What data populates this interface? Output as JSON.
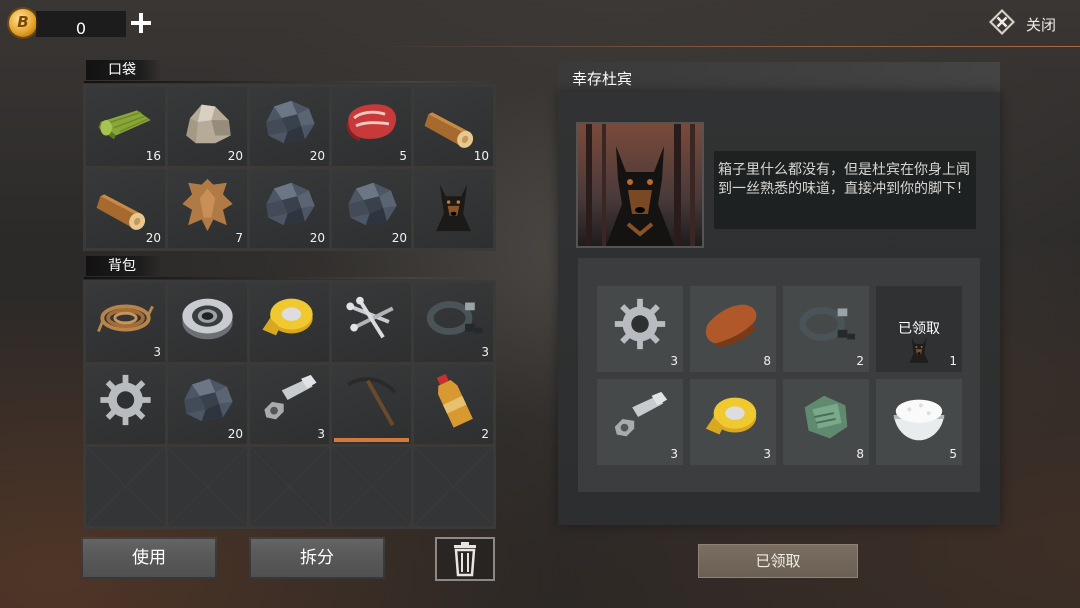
{
  "currency": {
    "icon": "gold-coin-icon",
    "symbol": "B",
    "amount": "0"
  },
  "close": {
    "label": "关闭"
  },
  "pocket": {
    "title": "口袋",
    "slots": [
      {
        "icon": "cloth-roll-icon",
        "qty": "16"
      },
      {
        "icon": "stone-icon",
        "qty": "20"
      },
      {
        "icon": "iron-ore-icon",
        "qty": "20"
      },
      {
        "icon": "raw-meat-icon",
        "qty": "5"
      },
      {
        "icon": "wood-log-icon",
        "qty": "10"
      },
      {
        "icon": "wood-log-icon",
        "qty": "20"
      },
      {
        "icon": "leather-hide-icon",
        "qty": "7"
      },
      {
        "icon": "iron-ore-icon",
        "qty": "20"
      },
      {
        "icon": "iron-ore-icon",
        "qty": "20"
      },
      {
        "icon": "dog-icon",
        "qty": ""
      }
    ]
  },
  "backpack": {
    "title": "背包",
    "slots": [
      {
        "icon": "rope-icon",
        "qty": "3"
      },
      {
        "icon": "bearing-icon",
        "qty": ""
      },
      {
        "icon": "duct-tape-icon",
        "qty": ""
      },
      {
        "icon": "nails-icon",
        "qty": ""
      },
      {
        "icon": "cable-ring-icon",
        "qty": "3"
      },
      {
        "icon": "gear-icon",
        "qty": ""
      },
      {
        "icon": "iron-ore-icon",
        "qty": "20"
      },
      {
        "icon": "bolt-nut-icon",
        "qty": "3"
      },
      {
        "icon": "pickaxe-icon",
        "qty": "",
        "durability": 1.0
      },
      {
        "icon": "bottle-icon",
        "qty": "2"
      }
    ]
  },
  "buttons": {
    "use": "使用",
    "split": "拆分"
  },
  "reward_panel": {
    "title": "幸存杜宾",
    "description": "箱子里什么都没有，但是杜宾在你身上闻到一丝熟悉的味道，直接冲到你的脚下！",
    "items": [
      {
        "icon": "gear-icon",
        "qty": "3"
      },
      {
        "icon": "leather-strip-icon",
        "qty": "8"
      },
      {
        "icon": "cable-ring-icon",
        "qty": "2"
      },
      {
        "icon": "dog-icon",
        "qty": "1",
        "status": "已领取"
      },
      {
        "icon": "bolt-nut-icon",
        "qty": "3"
      },
      {
        "icon": "duct-tape-icon",
        "qty": "3"
      },
      {
        "icon": "cloth-scraps-icon",
        "qty": "8"
      },
      {
        "icon": "rice-bowl-icon",
        "qty": "5"
      }
    ],
    "claim_button": "已领取"
  },
  "colors": {
    "accent": "#d27a3a",
    "panel": "#2c2e2f",
    "cell": "#333536"
  }
}
